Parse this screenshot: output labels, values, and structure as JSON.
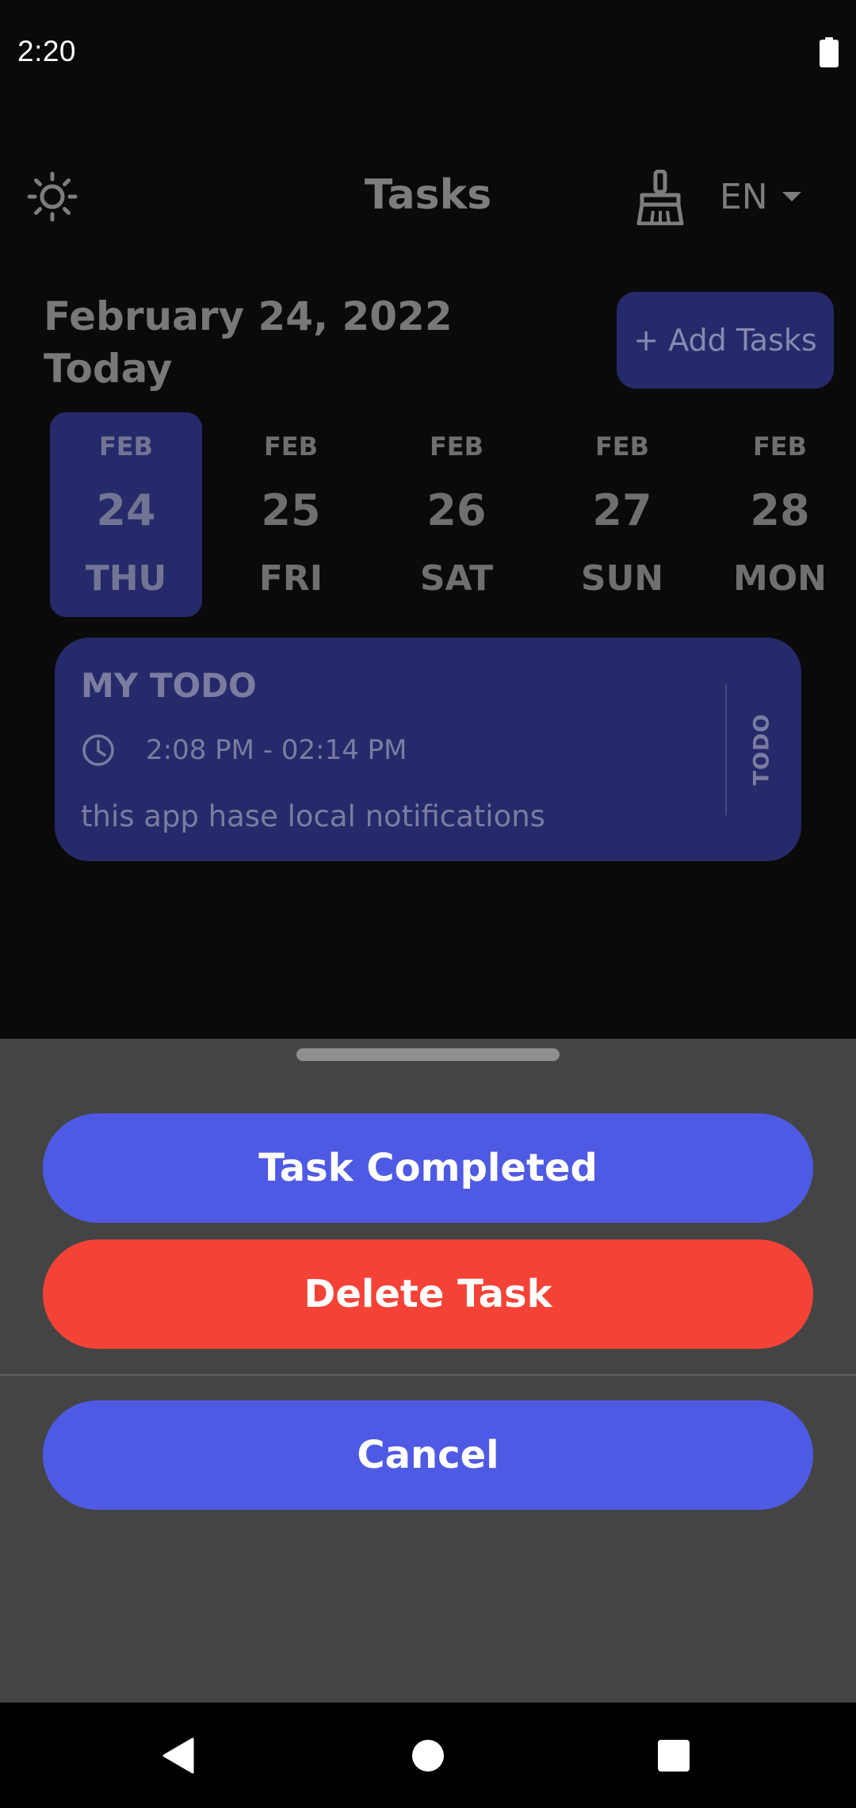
{
  "status_bar": {
    "time": "2:20",
    "battery_icon": "battery-icon"
  },
  "header": {
    "title": "Tasks",
    "theme_icon": "sun-icon",
    "clear_icon": "broom-icon",
    "language": "EN",
    "language_icon": "caret-down-icon"
  },
  "date_header": {
    "date": "February 24, 2022",
    "relative": "Today"
  },
  "add_button": {
    "label": "+ Add Tasks"
  },
  "date_strip": [
    {
      "month": "FEB",
      "day": "24",
      "weekday": "THU",
      "selected": true
    },
    {
      "month": "FEB",
      "day": "25",
      "weekday": "FRI",
      "selected": false
    },
    {
      "month": "FEB",
      "day": "26",
      "weekday": "SAT",
      "selected": false
    },
    {
      "month": "FEB",
      "day": "27",
      "weekday": "SUN",
      "selected": false
    },
    {
      "month": "FEB",
      "day": "28",
      "weekday": "MON",
      "selected": false
    }
  ],
  "task": {
    "title": "MY TODO",
    "time": "2:08 PM - 02:14 PM",
    "note": "this app hase local notifications",
    "status": "TODO",
    "time_icon": "clock-icon"
  },
  "sheet": {
    "complete_label": "Task Completed",
    "delete_label": "Delete Task",
    "cancel_label": "Cancel"
  },
  "nav": {
    "back_icon": "back-triangle-icon",
    "home_icon": "home-circle-icon",
    "recents_icon": "recents-square-icon"
  },
  "colors": {
    "background": "#0a0a0a",
    "card": "#262a6a",
    "primary_button": "#4f5ae4",
    "danger_button": "#f44336",
    "sheet": "#444444"
  }
}
